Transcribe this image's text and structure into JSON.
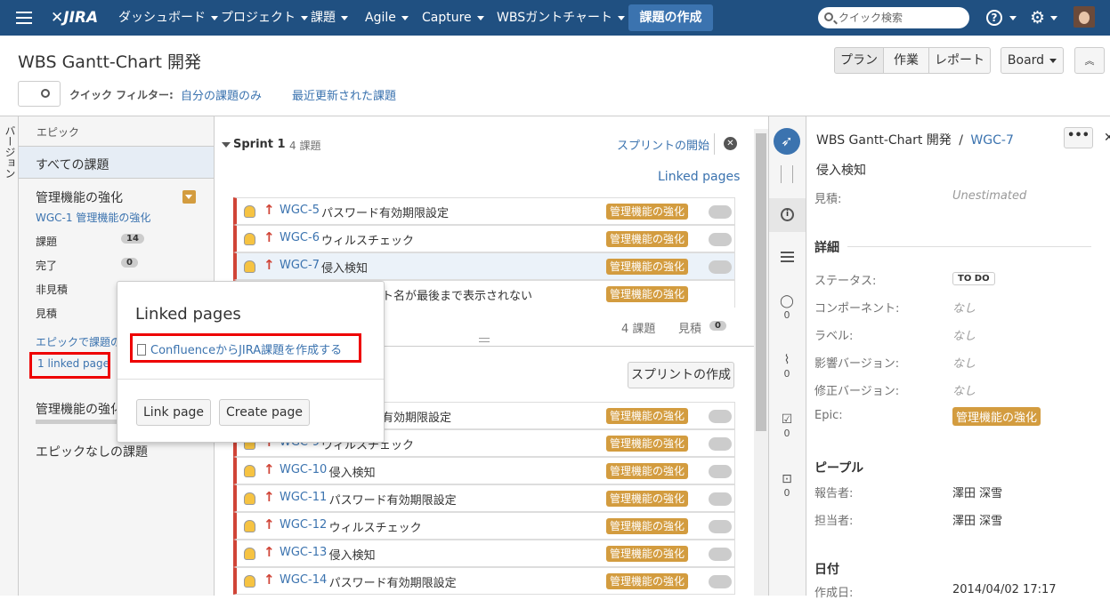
{
  "topnav": {
    "logo": "JIRA",
    "items": [
      "ダッシュボード",
      "プロジェクト",
      "課題",
      "Agile",
      "Capture",
      "WBSガントチャート"
    ],
    "create": "課題の作成",
    "search_placeholder": "クイック検索",
    "help": "?"
  },
  "header": {
    "title": "WBS Gantt-Chart 開発",
    "modes": [
      "プラン",
      "作業",
      "レポート"
    ],
    "board": "Board",
    "quick_filters_label": "クイック フィルター:",
    "filters": [
      "自分の課題のみ",
      "最近更新された課題"
    ]
  },
  "versions_label": "バージョン",
  "epics": {
    "heading": "エピック",
    "all": "すべての課題",
    "epic_name": "管理機能の強化",
    "epic_key": "WGC-1 管理機能の強化",
    "stats": [
      {
        "label": "課題",
        "count": "14"
      },
      {
        "label": "完了",
        "count": "0"
      },
      {
        "label": "非見積",
        "count": ""
      },
      {
        "label": "見積",
        "count": ""
      }
    ],
    "link_text": "エピックで課題の作",
    "linked_page": "1 linked page",
    "epic_name2": "管理機能の強化",
    "no_epic": "エピックなしの課題"
  },
  "sprint": {
    "name": "Sprint 1",
    "count": "4 課題",
    "start": "スプリントの開始",
    "linked_pages": "Linked pages",
    "footer_count": "4 課題",
    "footer_est_label": "見積",
    "footer_est": "0",
    "create_sprint": "スプリントの作成"
  },
  "sprint_issues": [
    {
      "key": "WGC-5",
      "summary": "パスワード有効期限設定",
      "epic": "管理機能の強化"
    },
    {
      "key": "WGC-6",
      "summary": "ウィルスチェック",
      "epic": "管理機能の強化"
    },
    {
      "key": "WGC-7",
      "summary": "侵入検知",
      "epic": "管理機能の強化"
    },
    {
      "key": "",
      "summary": "ト名が最後まで表示されない",
      "epic": "管理機能の強化"
    }
  ],
  "backlog_issues": [
    {
      "key": "",
      "summary": "有効期限設定",
      "epic": "管理機能の強化"
    },
    {
      "key": "WGC-9",
      "summary": "ウィルスチェック",
      "epic": "管理機能の強化"
    },
    {
      "key": "WGC-10",
      "summary": "侵入検知",
      "epic": "管理機能の強化"
    },
    {
      "key": "WGC-11",
      "summary": "パスワード有効期限設定",
      "epic": "管理機能の強化"
    },
    {
      "key": "WGC-12",
      "summary": "ウィルスチェック",
      "epic": "管理機能の強化"
    },
    {
      "key": "WGC-13",
      "summary": "侵入検知",
      "epic": "管理機能の強化"
    },
    {
      "key": "WGC-14",
      "summary": "パスワード有効期限設定",
      "epic": "管理機能の強化"
    }
  ],
  "popup": {
    "title": "Linked pages",
    "page": "ConfluenceからJIRA課題を作成する",
    "link_page": "Link page",
    "create_page": "Create page"
  },
  "detail": {
    "project": "WBS Gantt-Chart 開発",
    "sep": "/",
    "key": "WGC-7",
    "summary": "侵入検知",
    "estimate_label": "見積:",
    "estimate": "Unestimated",
    "details_heading": "詳細",
    "fields": [
      {
        "label": "ステータス:",
        "value": "TO DO"
      },
      {
        "label": "コンポーネント:",
        "value": "なし"
      },
      {
        "label": "ラベル:",
        "value": "なし"
      },
      {
        "label": "影響バージョン:",
        "value": "なし"
      },
      {
        "label": "修正バージョン:",
        "value": "なし"
      },
      {
        "label": "Epic:",
        "value": "管理機能の強化"
      }
    ],
    "people_heading": "ピープル",
    "reporter_label": "報告者:",
    "reporter": "澤田 深雪",
    "assignee_label": "担当者:",
    "assignee": "澤田 深雪",
    "dates_heading": "日付",
    "created_label": "作成日:",
    "created": "2014/04/02 17:17",
    "tab_counts": [
      "0",
      "0",
      "0",
      "0"
    ]
  },
  "colors": {
    "nav": "#205081",
    "epic": "#d39c3f",
    "link": "#3b73af",
    "priority": "#d04437",
    "highlight": "#e00000"
  }
}
